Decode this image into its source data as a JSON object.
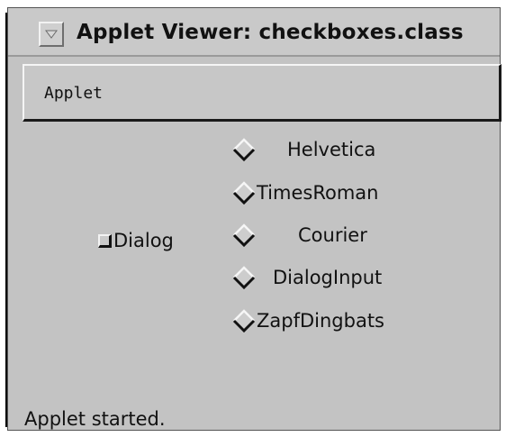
{
  "window": {
    "title": "Applet Viewer: checkboxes.class"
  },
  "menubar": {
    "items": [
      {
        "label": "Applet"
      }
    ]
  },
  "applet": {
    "checkbox": {
      "label": "Dialog",
      "checked": false
    },
    "radio_group": [
      {
        "label": "Helvetica",
        "selected": false
      },
      {
        "label": "TimesRoman",
        "selected": false
      },
      {
        "label": "Courier",
        "selected": false
      },
      {
        "label": "DialogInput",
        "selected": false
      },
      {
        "label": "ZapfDingbats",
        "selected": false
      }
    ]
  },
  "status": {
    "text": "Applet started."
  },
  "icons": {
    "window_menu": "triangle-down-icon",
    "radio": "diamond-icon",
    "checkbox": "square-checkbox-icon"
  },
  "colors": {
    "panel": "#c3c3c3",
    "text": "#111111"
  }
}
